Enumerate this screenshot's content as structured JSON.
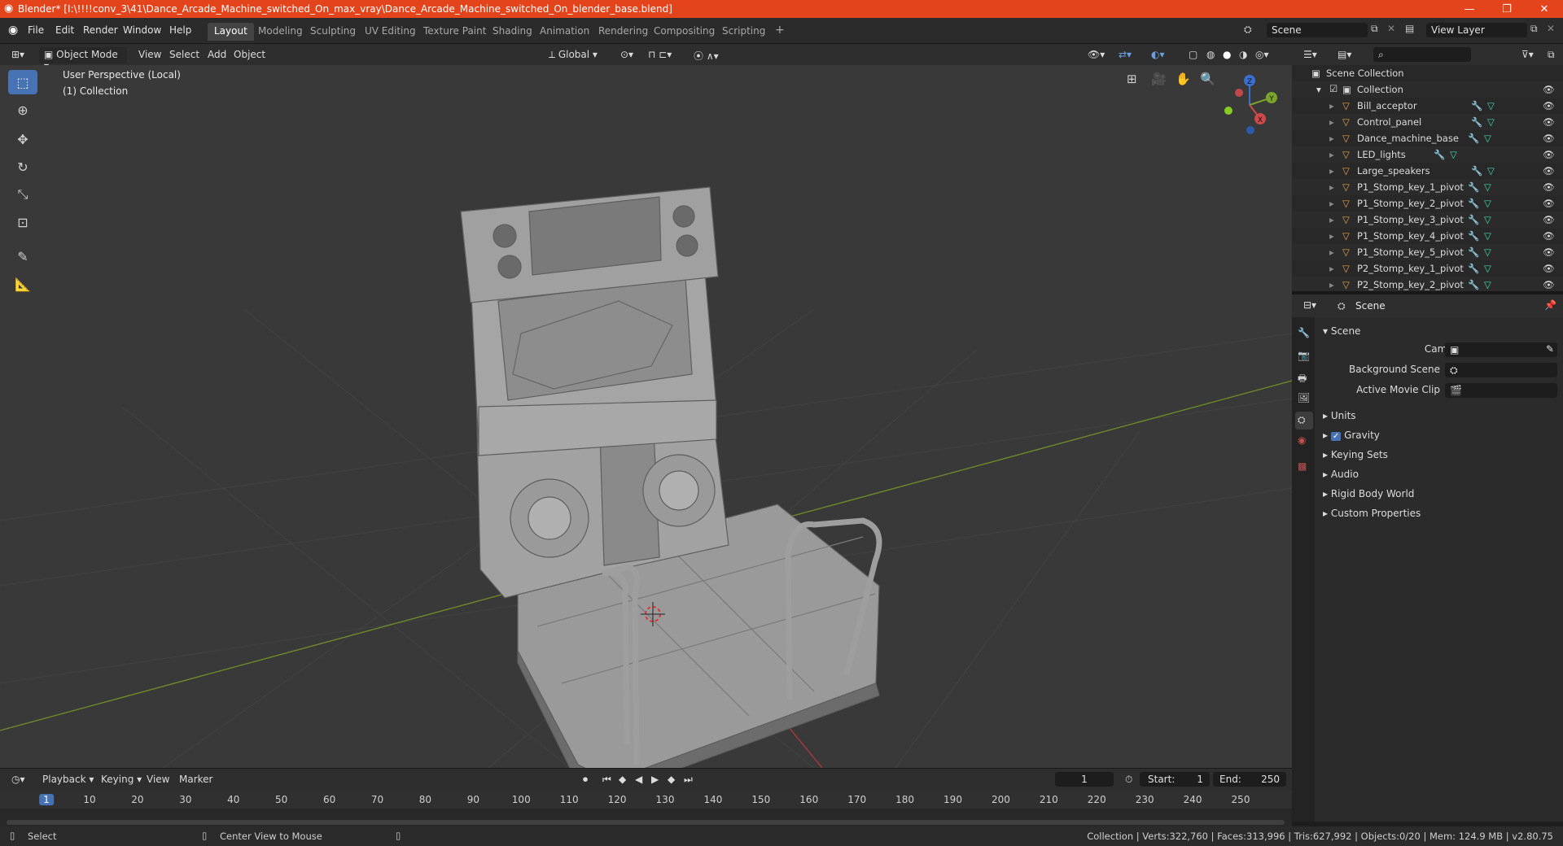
{
  "window": {
    "title": "Blender* [I:\\!!!!conv_3\\41\\Dance_Arcade_Machine_switched_On_max_vray\\Dance_Arcade_Machine_switched_On_blender_base.blend]",
    "minimize": "—",
    "restore": "❐",
    "close": "✕"
  },
  "menu": [
    "File",
    "Edit",
    "Render",
    "Window",
    "Help"
  ],
  "workspaces": [
    "Layout",
    "Modeling",
    "Sculpting",
    "UV Editing",
    "Texture Paint",
    "Shading",
    "Animation",
    "Rendering",
    "Compositing",
    "Scripting"
  ],
  "add_workspace": "+",
  "scene_field": "Scene",
  "view_layer_field": "View Layer",
  "viewport_header": {
    "mode": "Object Mode",
    "menus": [
      "View",
      "Select",
      "Add",
      "Object"
    ],
    "transform": "Global"
  },
  "viewport": {
    "perspective": "User Perspective (Local)",
    "collection": "(1) Collection",
    "gizmo": {
      "z": "Z",
      "y": "Y",
      "x": "X"
    }
  },
  "outliner": {
    "root": "Scene Collection",
    "collection": "Collection",
    "items": [
      "Bill_acceptor",
      "Control_panel",
      "Dance_machine_base",
      "LED_lights",
      "Large_speakers",
      "P1_Stomp_key_1_pivot",
      "P1_Stomp_key_2_pivot",
      "P1_Stomp_key_3_pivot",
      "P1_Stomp_key_4_pivot",
      "P1_Stomp_key_5_pivot",
      "P2_Stomp_key_1_pivot",
      "P2_Stomp_key_2_pivot"
    ]
  },
  "properties": {
    "context": "Scene",
    "panel": "Scene",
    "camera_label": "Camera",
    "background_scene_label": "Background Scene",
    "active_movie_clip_label": "Active Movie Clip",
    "sections": [
      "Units",
      "Gravity",
      "Keying Sets",
      "Audio",
      "Rigid Body World",
      "Custom Properties"
    ],
    "gravity_checked": true
  },
  "timeline": {
    "menus": [
      "Playback",
      "Keying",
      "View",
      "Marker"
    ],
    "current_frame": "1",
    "start_label": "Start:",
    "start": "1",
    "end_label": "End:",
    "end": "250",
    "ticks": [
      "1",
      "10",
      "20",
      "30",
      "40",
      "50",
      "60",
      "70",
      "80",
      "90",
      "100",
      "110",
      "120",
      "130",
      "140",
      "150",
      "160",
      "170",
      "180",
      "190",
      "200",
      "210",
      "220",
      "230",
      "240",
      "250"
    ]
  },
  "status": {
    "select": "Select",
    "center_view": "Center View to Mouse",
    "stats": "Collection | Verts:322,760 | Faces:313,996 | Tris:627,992 | Objects:0/20 | Mem: 124.9 MB | v2.80.75"
  },
  "colors": {
    "title_bar": "#e3441b",
    "active_tool": "#4772b3",
    "mesh_icon": "#e8a04a",
    "modifier_icon": "#6aa0e0",
    "data_icon": "#3fd8b0"
  }
}
